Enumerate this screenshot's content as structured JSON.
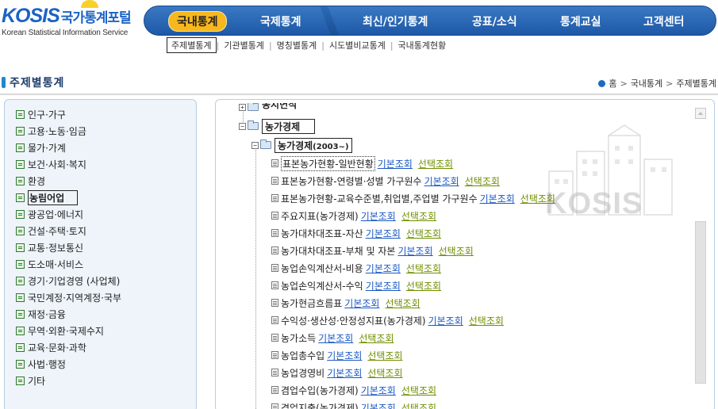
{
  "logo": {
    "brand": "KOSIS",
    "name": "국가통계포털",
    "subtitle": "Korean Statistical Information Service"
  },
  "topnav": {
    "items": [
      {
        "label": "국내통계",
        "active": true
      },
      {
        "label": "국제통계",
        "active": false
      },
      {
        "label": "최신/인기통계",
        "active": false
      },
      {
        "label": "공표/소식",
        "active": false
      },
      {
        "label": "통계교실",
        "active": false
      },
      {
        "label": "고객센터",
        "active": false
      }
    ]
  },
  "subnav": {
    "items": [
      {
        "label": "주제별통계",
        "active": true
      },
      {
        "label": "기관별통계"
      },
      {
        "label": "명칭별통계"
      },
      {
        "label": "시도별비교통계"
      },
      {
        "label": "국내통계현황"
      }
    ]
  },
  "page": {
    "title": "주제별통계"
  },
  "breadcrumb": {
    "items": [
      "홈",
      "국내통계",
      "주제별통계"
    ]
  },
  "categories": [
    "인구·가구",
    "고용·노동·임금",
    "물가·가계",
    "보건·사회·복지",
    "환경",
    "농림어업",
    "광공업·에너지",
    "건설·주택·토지",
    "교통·정보통신",
    "도소매·서비스",
    "경기·기업경영 (사업체)",
    "국민계정·지역계정·국부",
    "재정·금융",
    "무역·외환·국제수지",
    "교육·문화·과학",
    "사법·행정",
    "기타"
  ],
  "active_category": "농림어업",
  "tree": {
    "cut_node": "농지면적",
    "parent": "농가경제",
    "child": "농가경제",
    "child_suffix": "(2003~)",
    "link_basic": "기본조회",
    "link_select": "선택조회",
    "tables": [
      "표본농가현황-일반현황",
      "표본농가현황-연령별·성별 가구원수",
      "표본농가현황-교육수준별,취업별,주업별 가구원수",
      "주요지표(농가경제)",
      "농가대차대조표-자산",
      "농가대차대조표-부채 및 자본",
      "농업손익계산서-비용",
      "농업손익계산서-수익",
      "농가현금흐름표",
      "수익성·생산성·안정성지표(농가경제)",
      "농가소득",
      "농업총수입",
      "농업경영비",
      "겸업수입(농가경제)",
      "겸업지출(농가경제)"
    ]
  },
  "watermark": "KOSIS",
  "colors": {
    "nav_blue": "#1d58a6",
    "nav_active": "#f7b71d",
    "link_basic": "#1a58c4",
    "link_select": "#6f8f00"
  }
}
